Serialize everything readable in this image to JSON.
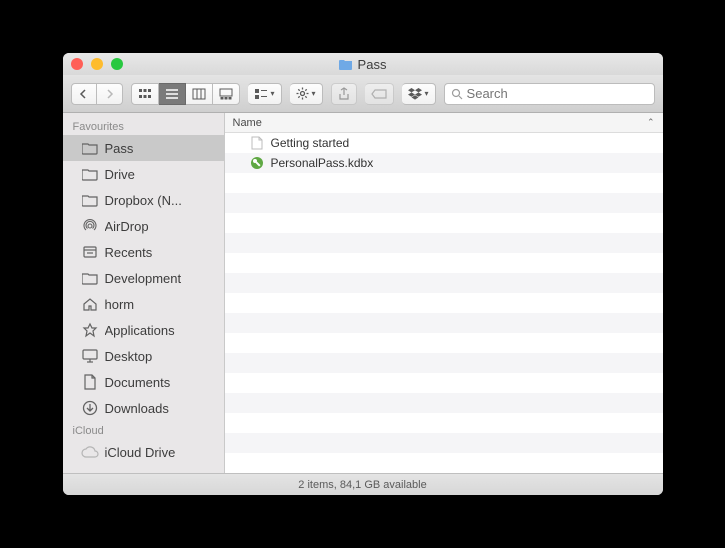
{
  "window": {
    "title": "Pass"
  },
  "toolbar": {
    "search_placeholder": "Search"
  },
  "sidebar": {
    "sections": [
      {
        "header": "Favourites",
        "items": [
          {
            "label": "Pass",
            "icon": "folder",
            "selected": true
          },
          {
            "label": "Drive",
            "icon": "folder"
          },
          {
            "label": "Dropbox (N...",
            "icon": "folder"
          },
          {
            "label": "AirDrop",
            "icon": "airdrop"
          },
          {
            "label": "Recents",
            "icon": "recents"
          },
          {
            "label": "Development",
            "icon": "folder"
          },
          {
            "label": "horm",
            "icon": "home"
          },
          {
            "label": "Applications",
            "icon": "applications"
          },
          {
            "label": "Desktop",
            "icon": "desktop"
          },
          {
            "label": "Documents",
            "icon": "documents"
          },
          {
            "label": "Downloads",
            "icon": "downloads"
          }
        ]
      },
      {
        "header": "iCloud",
        "items": [
          {
            "label": "iCloud Drive",
            "icon": "icloud"
          }
        ]
      }
    ]
  },
  "columns": {
    "name": "Name"
  },
  "files": [
    {
      "name": "Getting started",
      "icon": "document"
    },
    {
      "name": "PersonalPass.kdbx",
      "icon": "keepass"
    }
  ],
  "status": "2 items, 84,1 GB available"
}
